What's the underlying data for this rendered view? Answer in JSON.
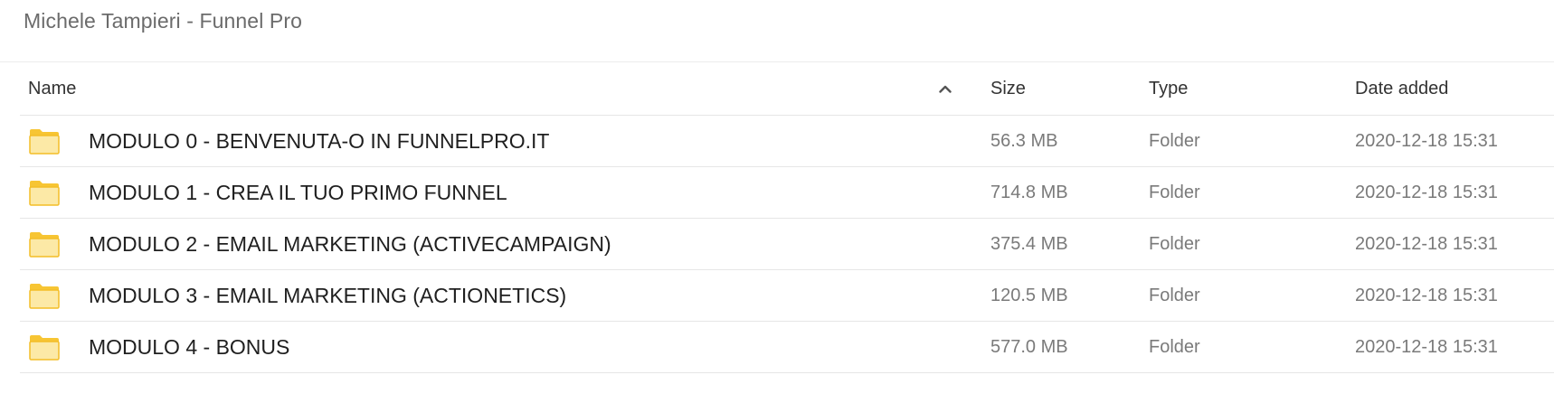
{
  "breadcrumb": "Michele Tampieri - Funnel Pro",
  "columns": {
    "name": "Name",
    "size": "Size",
    "type": "Type",
    "date": "Date added"
  },
  "sort": {
    "column": "Name",
    "direction": "ascending",
    "icon": "chevron-up-icon"
  },
  "folder_color": "#f7c533",
  "rows": [
    {
      "name": "MODULO 0 - BENVENUTA-O IN FUNNELPRO.IT",
      "size": "56.3 MB",
      "type": "Folder",
      "date": "2020-12-18 15:31",
      "icon": "folder-icon"
    },
    {
      "name": "MODULO 1 - CREA IL TUO PRIMO FUNNEL",
      "size": "714.8 MB",
      "type": "Folder",
      "date": "2020-12-18 15:31",
      "icon": "folder-icon"
    },
    {
      "name": "MODULO 2 - EMAIL MARKETING (ACTIVECAMPAIGN)",
      "size": "375.4 MB",
      "type": "Folder",
      "date": "2020-12-18 15:31",
      "icon": "folder-icon"
    },
    {
      "name": "MODULO 3 - EMAIL MARKETING (ACTIONETICS)",
      "size": "120.5 MB",
      "type": "Folder",
      "date": "2020-12-18 15:31",
      "icon": "folder-icon"
    },
    {
      "name": "MODULO 4 - BONUS",
      "size": "577.0 MB",
      "type": "Folder",
      "date": "2020-12-18 15:31",
      "icon": "folder-icon"
    }
  ]
}
